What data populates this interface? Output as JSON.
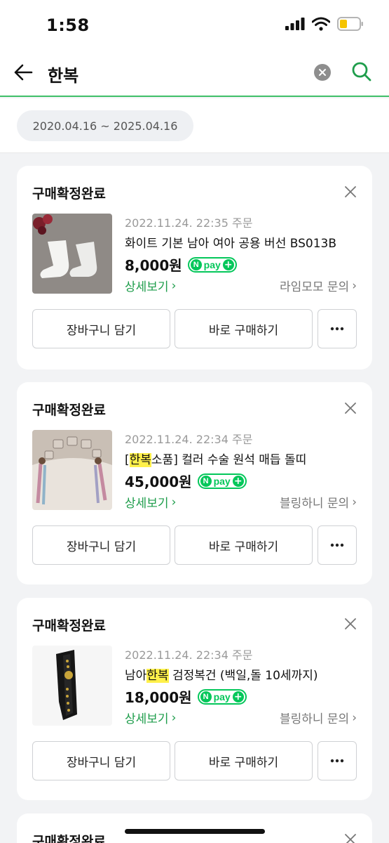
{
  "status_bar": {
    "time": "1:58"
  },
  "search": {
    "query": "한복"
  },
  "filter": {
    "date_range": "2020.04.16 ~ 2025.04.16"
  },
  "npay_label": "pay",
  "orders": [
    {
      "status": "구매확정완료",
      "order_date": "2022.11.24. 22:35 주문",
      "product_pre": "화이트 기본 남아 여아 공용 버선 BS013B",
      "product_hl": "",
      "product_post": "",
      "price": "8,000원",
      "detail_label": "상세보기",
      "seller_label": "라임모모 문의",
      "cart_label": "장바구니 담기",
      "buy_label": "바로 구매하기"
    },
    {
      "status": "구매확정완료",
      "order_date": "2022.11.24. 22:34 주문",
      "product_pre": "[",
      "product_hl": "한복",
      "product_post": "소품] 컬러 수술 원석 매듭 돌띠",
      "price": "45,000원",
      "detail_label": "상세보기",
      "seller_label": "블링하니 문의",
      "cart_label": "장바구니 담기",
      "buy_label": "바로 구매하기"
    },
    {
      "status": "구매확정완료",
      "order_date": "2022.11.24. 22:34 주문",
      "product_pre": "남아",
      "product_hl": "한복",
      "product_post": " 검정복건 (백일,돌 10세까지)",
      "price": "18,000원",
      "detail_label": "상세보기",
      "seller_label": "블링하니 문의",
      "cart_label": "장바구니 담기",
      "buy_label": "바로 구매하기"
    },
    {
      "status": "구매확정완료"
    }
  ],
  "colors": {
    "accent_green": "#1e9d4b",
    "npay_green": "#03c75a",
    "highlight": "#fff04a"
  }
}
